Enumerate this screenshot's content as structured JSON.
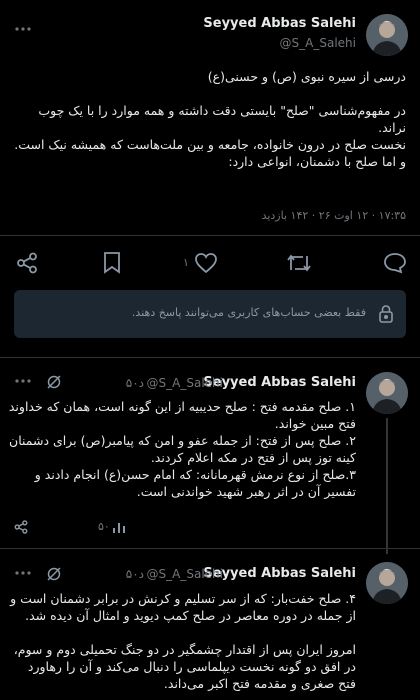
{
  "main_tweet": {
    "name": "Seyyed Abbas Salehi",
    "handle": "@S_A_Salehi",
    "body": "درسی از سیره نبوی (ص) و حسنی(ع)\n\nدر مفهوم‌شناسی \"صلح\" بایستی دقت داشته و همه موارد را با یک چوب نراند.\nنخست صلح در درون خانواده، جامعه و بین ملت‌هاست که  همیشه نیک است.\nو اما صلح با دشمنان،  انواعی دارد:",
    "meta": "۱۷:۳۵ · ۱۲ اوت ۲۶ · ۱۴۲ بازدید",
    "actions": {
      "reply_count": "",
      "retweet_count": "",
      "like_count": "۱",
      "bookmark_count": ""
    },
    "reply_notice": "فقط بعضی حساب‌های کاربری می‌توانند پاسخ دهند."
  },
  "reply1": {
    "name": "Seyyed Abbas Salehi",
    "handle": "@S_A_Salehi",
    "time": "۵۰د",
    "body": "۱. صلح مقدمه فتح : صلح حدیبیه از این گونه است، همان که خداوند فتح مبین خواند.\n۲. صلح پس از فتح: از جمله عفو و امن که پیامبر(ص) برای دشمنان کینه توز پس از  فتح در مکه اعلام کردند.\n۳.صلح از نوع نرمش قهرمانانه:  که امام حسن(ع) انجام دادند و تفسیر آن در اثر رهبر شهید خواندنی است.",
    "view_count": "۵۰"
  },
  "reply2": {
    "name": "Seyyed Abbas Salehi",
    "handle": "@S_A_Salehi",
    "time": "۵۰د",
    "body": "۴. صلح خفت‌بار: که از سر تسلیم و کرنش در برابر دشمنان است و از جمله در دوره معاصر در صلح کمپ دیوید و امثال آن دیده شد.\n\nامروز ایران پس از اقتدار چشمگیر در دو جنگ تحمیلی دوم  و سوم،  در افق دو گونه نخست دیپلماسی را دنبال می‌کند و آن را رهاورد فتح صغری و مقدمه فتح اکبر می‌داند."
  },
  "colors": {
    "background": "#000000",
    "text": "#e7e9ea",
    "muted": "#71767b",
    "divider": "#2f3336",
    "notice_bg": "#1c2732"
  }
}
